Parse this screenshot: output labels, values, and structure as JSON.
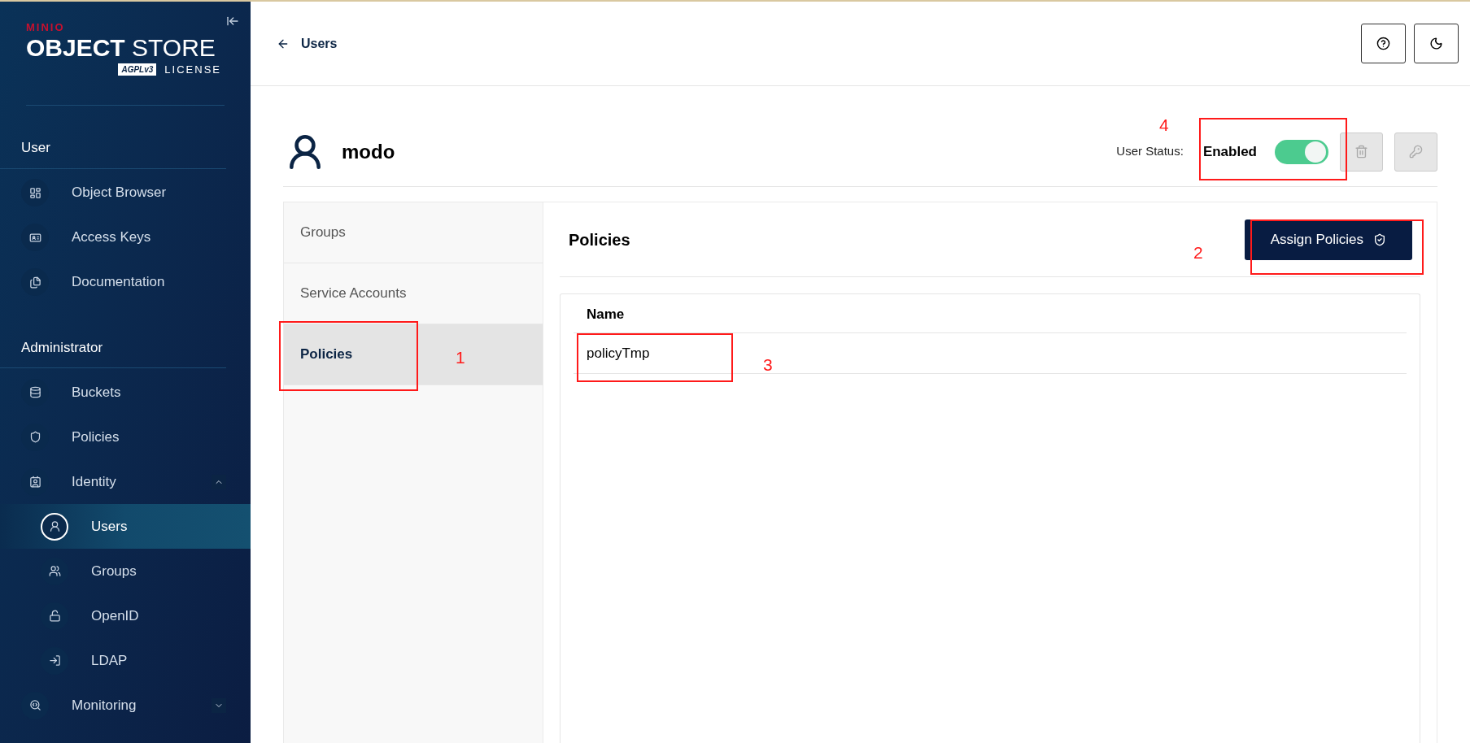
{
  "sidebar": {
    "logo": {
      "brand": "MINIO",
      "product_bold": "OBJECT",
      "product_light": "STORE",
      "badge": "AGPLv3",
      "license": "LICENSE"
    },
    "sections": [
      {
        "title": "User",
        "items": [
          {
            "label": "Object Browser",
            "selected": false
          },
          {
            "label": "Access Keys",
            "selected": false
          },
          {
            "label": "Documentation",
            "selected": false
          }
        ]
      },
      {
        "title": "Administrator",
        "items": [
          {
            "label": "Buckets",
            "selected": false
          },
          {
            "label": "Policies",
            "selected": false
          },
          {
            "label": "Identity",
            "selected": false,
            "expanded": true,
            "children": [
              {
                "label": "Users",
                "selected": true
              },
              {
                "label": "Groups",
                "selected": false
              },
              {
                "label": "OpenID",
                "selected": false
              },
              {
                "label": "LDAP",
                "selected": false
              }
            ]
          },
          {
            "label": "Monitoring",
            "selected": false,
            "expanded": false
          }
        ]
      }
    ]
  },
  "header": {
    "back_label": "Users"
  },
  "user": {
    "name": "modo",
    "status_label": "User Status:",
    "status_value": "Enabled",
    "enabled": true
  },
  "tabs": [
    {
      "label": "Groups",
      "selected": false
    },
    {
      "label": "Service Accounts",
      "selected": false
    },
    {
      "label": "Policies",
      "selected": true
    }
  ],
  "panel": {
    "title": "Policies",
    "button": "Assign Policies",
    "table": {
      "columns": [
        "Name"
      ],
      "rows": [
        [
          "policyTmp"
        ]
      ]
    }
  },
  "annotations": [
    {
      "number": "4",
      "kind": "status"
    },
    {
      "number": "2",
      "kind": "button"
    },
    {
      "number": "1",
      "kind": "tab"
    },
    {
      "number": "3",
      "kind": "row"
    }
  ]
}
